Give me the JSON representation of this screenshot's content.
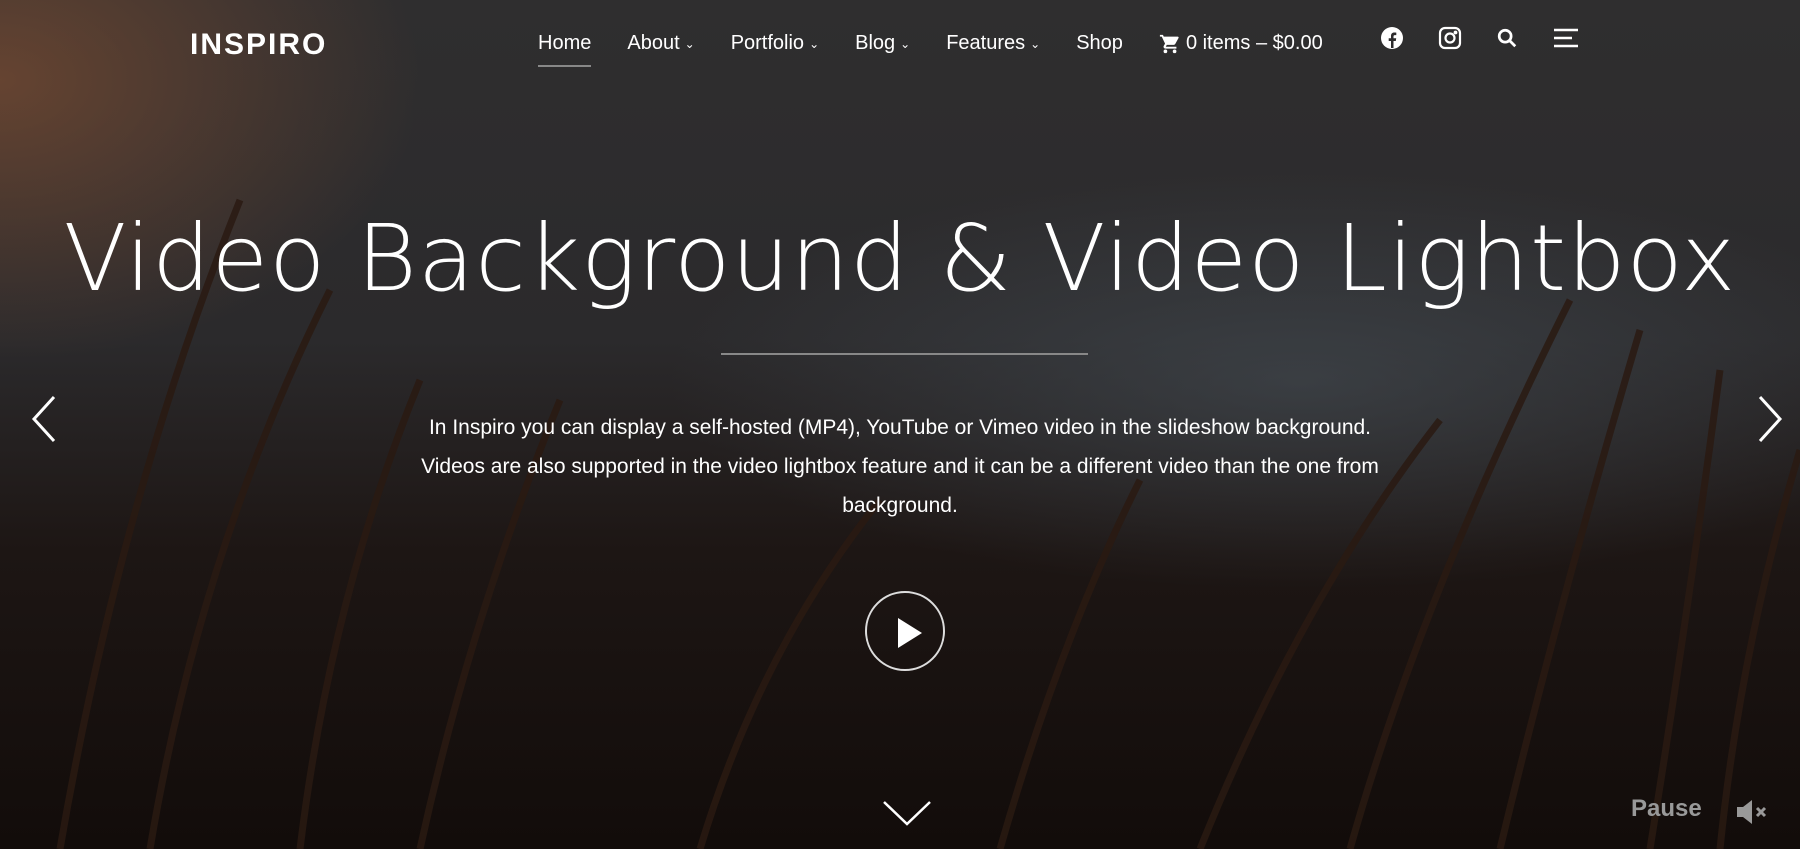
{
  "header": {
    "logo": "INSPIRO",
    "nav": [
      {
        "label": "Home",
        "dropdown": false
      },
      {
        "label": "About",
        "dropdown": true
      },
      {
        "label": "Portfolio",
        "dropdown": true
      },
      {
        "label": "Blog",
        "dropdown": true
      },
      {
        "label": "Features",
        "dropdown": true
      },
      {
        "label": "Shop",
        "dropdown": false
      }
    ],
    "cart": "0 items – $0.00"
  },
  "hero": {
    "title": "Video Background & Video Lightbox",
    "description_lines": [
      "In Inspiro you can display a self-hosted (MP4), YouTube or Vimeo video in the slideshow background.",
      "Videos are also supported in the video lightbox feature and it can be a different video than the one from",
      "background."
    ]
  },
  "controls": {
    "pause_label": "Pause"
  }
}
